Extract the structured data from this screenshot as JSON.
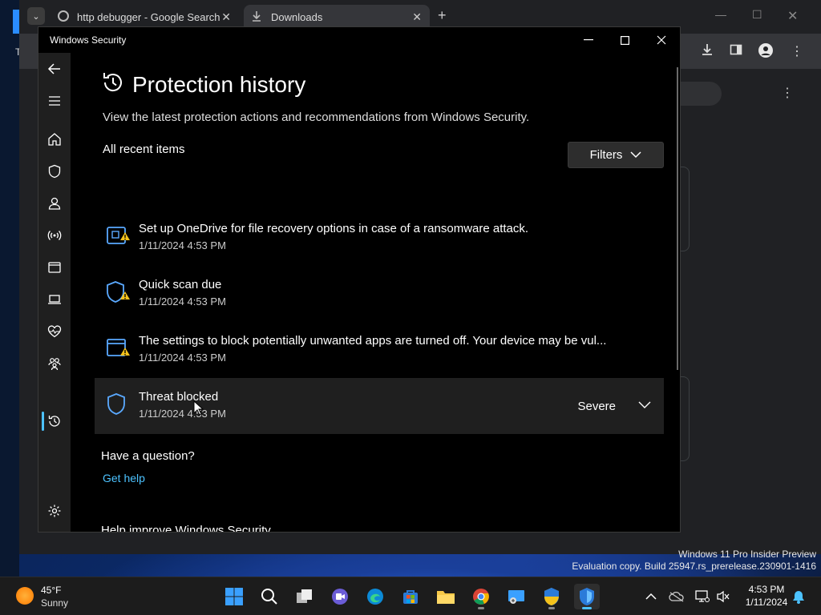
{
  "browser": {
    "tabs": [
      {
        "label": "http debugger - Google Search",
        "icon": "google-icon"
      },
      {
        "label": "Downloads",
        "icon": "download-icon"
      }
    ],
    "left_edge_letter": "T"
  },
  "security": {
    "window_title": "Windows Security",
    "page_title": "Protection history",
    "description": "View the latest protection actions and recommendations from Windows Security.",
    "section_label": "All recent items",
    "filters_label": "Filters",
    "items": [
      {
        "title": "Set up OneDrive for file recovery options in case of a ransomware attack.",
        "date": "1/11/2024 4:53 PM",
        "icon": "ransomware-warning-icon"
      },
      {
        "title": "Quick scan due",
        "date": "1/11/2024 4:53 PM",
        "icon": "shield-warning-icon"
      },
      {
        "title": "The settings to block potentially unwanted apps are turned off. Your device may be vul...",
        "date": "1/11/2024 4:53 PM",
        "icon": "app-browser-warning-icon"
      },
      {
        "title": "Threat blocked",
        "date": "1/11/2024 4:53 PM",
        "severity": "Severe",
        "icon": "shield-icon"
      }
    ],
    "question_label": "Have a question?",
    "help_link": "Get help",
    "improve_label": "Help improve Windows Security",
    "accent": "#4cc2ff",
    "warning_color": "#f4c21b"
  },
  "watermark": {
    "line1": "Windows 11 Pro Insider Preview",
    "line2": "Evaluation copy. Build 25947.rs_prerelease.230901-1416"
  },
  "taskbar": {
    "temperature": "45°F",
    "condition": "Sunny",
    "time": "4:53 PM",
    "date": "1/11/2024"
  }
}
